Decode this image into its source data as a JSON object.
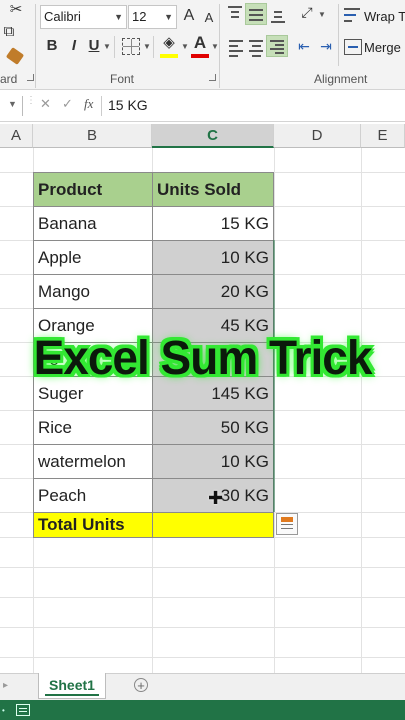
{
  "ribbon": {
    "font_name": "Calibri",
    "font_size": "12",
    "bold": "B",
    "italic": "I",
    "underline": "U",
    "font_color_glyph": "A",
    "grow_font": "A",
    "shrink_font": "A",
    "wrap_text": "Wrap T",
    "merge": "Merge",
    "group_clipboard": "ard",
    "group_font": "Font",
    "group_alignment": "Alignment"
  },
  "formula_bar": {
    "fx": "fx",
    "cancel": "✕",
    "enter": "✓",
    "value": "15 KG"
  },
  "columns": [
    "A",
    "B",
    "C",
    "D",
    "E"
  ],
  "table": {
    "headers": [
      "Product",
      "Units Sold"
    ],
    "rows": [
      {
        "product": "Banana",
        "units": "15 KG"
      },
      {
        "product": "Apple",
        "units": "10 KG"
      },
      {
        "product": "Mango",
        "units": "20 KG"
      },
      {
        "product": "Orange",
        "units": "45 KG"
      },
      {
        "product": "Po",
        "units": ""
      },
      {
        "product": "Suger",
        "units": "145 KG"
      },
      {
        "product": "Rice",
        "units": "50 KG"
      },
      {
        "product": "watermelon",
        "units": "10 KG"
      },
      {
        "product": "Peach",
        "units": "30 KG"
      }
    ],
    "total_label": "Total Units",
    "total_value": ""
  },
  "overlay_title": "Excel Sum Trick",
  "sheet_tab": "Sheet1",
  "colors": {
    "header_green": "#a9d08e",
    "total_yellow": "#ffff00",
    "selected_gray": "#d0d0d0",
    "excel_green": "#217346",
    "overlay_outline": "#33e833"
  }
}
